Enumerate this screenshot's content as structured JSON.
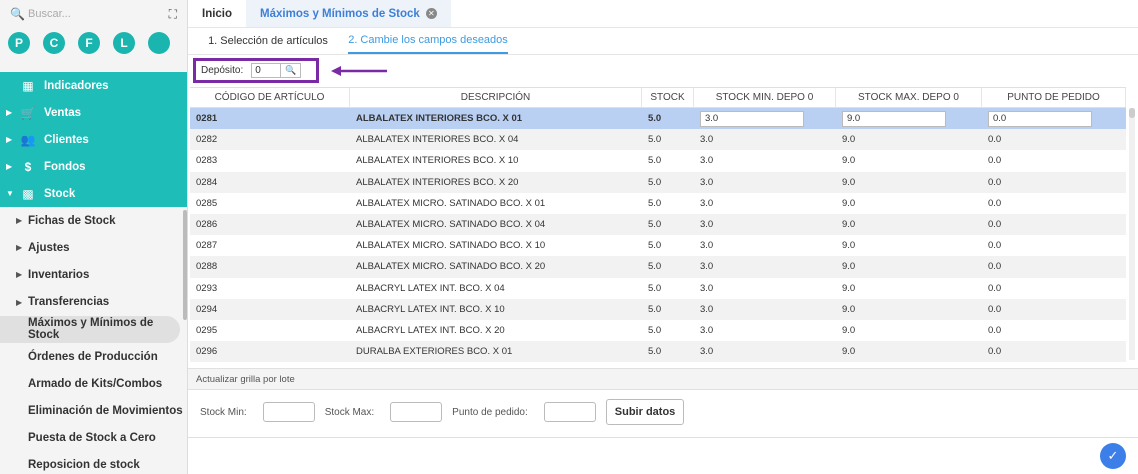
{
  "sidebar": {
    "search_placeholder": "Buscar...",
    "shortcuts": [
      "P",
      "C",
      "F",
      "L",
      ""
    ],
    "modules": [
      {
        "label": "Indicadores",
        "icon": "dashboard-icon"
      },
      {
        "label": "Ventas",
        "icon": "cart-icon"
      },
      {
        "label": "Clientes",
        "icon": "users-icon"
      },
      {
        "label": "Fondos",
        "icon": "dollar-icon"
      },
      {
        "label": "Stock",
        "icon": "box-icon"
      }
    ],
    "stock_items": [
      {
        "label": "Fichas de Stock"
      },
      {
        "label": "Ajustes"
      },
      {
        "label": "Inventarios"
      },
      {
        "label": "Transferencias"
      },
      {
        "label": "Máximos y Mínimos de Stock"
      },
      {
        "label": "Órdenes de Producción"
      },
      {
        "label": "Armado de Kits/Combos"
      },
      {
        "label": "Eliminación de Movimientos"
      },
      {
        "label": "Puesta de Stock a Cero"
      },
      {
        "label": "Reposicion de stock"
      }
    ]
  },
  "tabs": {
    "home": "Inicio",
    "current": "Máximos y Mínimos de Stock"
  },
  "steps": [
    "1. Selección de artículos",
    "2. Cambie los campos deseados"
  ],
  "deposit": {
    "label": "Depósito:",
    "value": "0"
  },
  "table": {
    "headers": [
      "CÓDIGO DE ARTÍCULO",
      "DESCRIPCIÓN",
      "STOCK",
      "STOCK MIN. DEPO 0",
      "STOCK MAX. DEPO 0",
      "PUNTO DE PEDIDO"
    ],
    "rows": [
      [
        "0281",
        "ALBALATEX INTERIORES BCO. X 01",
        "5.0",
        "3.0",
        "9.0",
        "0.0"
      ],
      [
        "0282",
        "ALBALATEX INTERIORES BCO. X 04",
        "5.0",
        "3.0",
        "9.0",
        "0.0"
      ],
      [
        "0283",
        "ALBALATEX INTERIORES BCO. X 10",
        "5.0",
        "3.0",
        "9.0",
        "0.0"
      ],
      [
        "0284",
        "ALBALATEX INTERIORES BCO. X 20",
        "5.0",
        "3.0",
        "9.0",
        "0.0"
      ],
      [
        "0285",
        "ALBALATEX MICRO. SATINADO BCO. X 01",
        "5.0",
        "3.0",
        "9.0",
        "0.0"
      ],
      [
        "0286",
        "ALBALATEX MICRO. SATINADO BCO. X 04",
        "5.0",
        "3.0",
        "9.0",
        "0.0"
      ],
      [
        "0287",
        "ALBALATEX MICRO. SATINADO BCO. X 10",
        "5.0",
        "3.0",
        "9.0",
        "0.0"
      ],
      [
        "0288",
        "ALBALATEX MICRO. SATINADO BCO. X 20",
        "5.0",
        "3.0",
        "9.0",
        "0.0"
      ],
      [
        "0293",
        "ALBACRYL LATEX INT. BCO. X 04",
        "5.0",
        "3.0",
        "9.0",
        "0.0"
      ],
      [
        "0294",
        "ALBACRYL LATEX INT. BCO. X 10",
        "5.0",
        "3.0",
        "9.0",
        "0.0"
      ],
      [
        "0295",
        "ALBACRYL LATEX INT. BCO. X 20",
        "5.0",
        "3.0",
        "9.0",
        "0.0"
      ],
      [
        "0296",
        "DURALBA EXTERIORES BCO. X 01",
        "5.0",
        "3.0",
        "9.0",
        "0.0"
      ]
    ]
  },
  "batch": {
    "title": "Actualizar grilla por lote",
    "stock_min_label": "Stock Min:",
    "stock_max_label": "Stock Max:",
    "reorder_label": "Punto de pedido:",
    "submit_label": "Subir datos"
  },
  "colors": {
    "accent": "#1fbdb8",
    "highlight": "#7a2aa5",
    "selected_row": "#b9d0f3",
    "link": "#3d7fd6"
  }
}
